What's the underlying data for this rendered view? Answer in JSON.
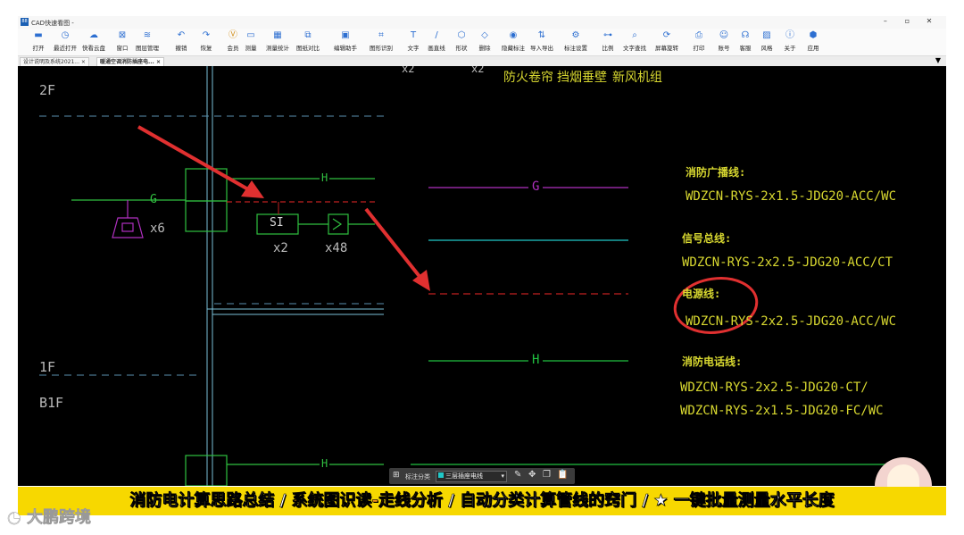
{
  "window": {
    "title": "CAD快速看图 -",
    "controls": [
      "–",
      "▫",
      "✕"
    ]
  },
  "toolbar": [
    {
      "label": "打开",
      "icon": "folder-icon"
    },
    {
      "label": "最近打开",
      "icon": "clock-icon"
    },
    {
      "label": "快看云盘",
      "icon": "cloud-icon"
    },
    {
      "label": "窗口",
      "icon": "window-icon"
    },
    {
      "label": "图层管理",
      "icon": "layers-icon"
    },
    {
      "label": "撤销",
      "icon": "undo-icon"
    },
    {
      "label": "恢复",
      "icon": "redo-icon"
    },
    {
      "label": "会员",
      "icon": "vip-icon"
    },
    {
      "label": "测量",
      "icon": "measure-icon"
    },
    {
      "label": "测量统计",
      "icon": "stats-icon"
    },
    {
      "label": "图纸对比",
      "icon": "compare-icon"
    },
    {
      "label": "编辑助手",
      "icon": "edit-helper-icon"
    },
    {
      "label": "图形识别",
      "icon": "recognize-icon"
    },
    {
      "label": "文字",
      "icon": "text-icon"
    },
    {
      "label": "画直线",
      "icon": "line-icon"
    },
    {
      "label": "形状",
      "icon": "shape-icon"
    },
    {
      "label": "删除",
      "icon": "eraser-icon"
    },
    {
      "label": "隐藏标注",
      "icon": "eye-icon"
    },
    {
      "label": "导入导出",
      "icon": "import-export-icon"
    },
    {
      "label": "标注设置",
      "icon": "annotation-settings-icon"
    },
    {
      "label": "比例",
      "icon": "scale-icon"
    },
    {
      "label": "文字查找",
      "icon": "find-text-icon"
    },
    {
      "label": "屏幕旋转",
      "icon": "rotate-icon"
    },
    {
      "label": "打印",
      "icon": "print-icon"
    },
    {
      "label": "账号",
      "icon": "user-icon"
    },
    {
      "label": "客服",
      "icon": "headset-icon"
    },
    {
      "label": "风格",
      "icon": "style-icon"
    },
    {
      "label": "关于",
      "icon": "info-icon"
    },
    {
      "label": "应用",
      "icon": "apps-icon"
    }
  ],
  "tabs": [
    {
      "label": "设计说明及系统2021...",
      "close": "×",
      "active": false
    },
    {
      "label": "暖通空调消防插座电...",
      "close": "×",
      "active": true
    }
  ],
  "drawing": {
    "floors": [
      "2F",
      "1F",
      "B1F"
    ],
    "top_labels": [
      "x2",
      "x2",
      "防火卷帘",
      "挡烟垂壁",
      "新风机组"
    ],
    "symbols": {
      "g_mark": "G",
      "h_mark": "H",
      "si_box": "SI",
      "qty_speaker": "x6",
      "qty_si": "x2",
      "qty_module": "x48"
    },
    "legend": [
      {
        "title": "消防广播线:",
        "spec": "WDZCN-RYS-2x1.5-JDG20-ACC/WC",
        "line_color": "#b030c0",
        "mark": "G"
      },
      {
        "title": "信号总线:",
        "spec": "WDZCN-RYS-2x2.5-JDG20-ACC/CT",
        "line_color": "#20c8c8",
        "mark": ""
      },
      {
        "title": "电源线:",
        "spec": "WDZCN-RYS-2x2.5-JDG20-ACC/WC",
        "line_color": "#c02020",
        "mark": ""
      },
      {
        "title": "消防电话线:",
        "spec": "WDZCN-RYS-2x2.5-JDG20-CT/",
        "spec2": "WDZCN-RYS-2x1.5-JDG20-FC/WC",
        "line_color": "#20c040",
        "mark": "H"
      }
    ]
  },
  "bottom_toolbar": {
    "label": "标注分类",
    "selected": "三层插座电线"
  },
  "subtitle": {
    "part1": "消防电计算思路总结 / ",
    "highlight": "系统图识读-走线分析",
    "part2": " / 自动分类计算管线的窍门 / ★ 一键批量测量水平长度"
  },
  "watermark": "大鹏跨境",
  "colors": {
    "canvas": "#000000",
    "annotation": "#e03030",
    "subtitle_bg": "#f7d800",
    "highlight": "#ff9a1a"
  }
}
